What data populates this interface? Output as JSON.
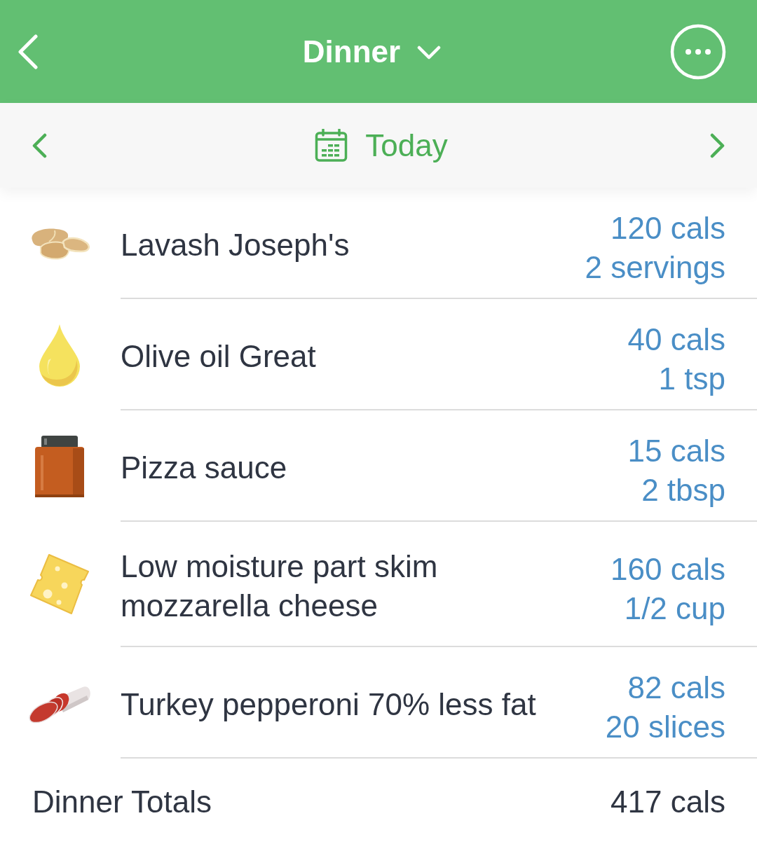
{
  "header": {
    "title": "Dinner"
  },
  "date_bar": {
    "label": "Today"
  },
  "entries": [
    {
      "kind": "bread",
      "name": "Lavash Joseph's",
      "calories": "120 cals",
      "serving": "2 servings"
    },
    {
      "kind": "oil",
      "name": "Olive oil Great",
      "calories": "40 cals",
      "serving": "1 tsp"
    },
    {
      "kind": "jar",
      "name": "Pizza sauce",
      "calories": "15 cals",
      "serving": "2 tbsp"
    },
    {
      "kind": "cheese",
      "name": "Low moisture part skim mozzarella cheese",
      "calories": "160 cals",
      "serving": "1/2 cup"
    },
    {
      "kind": "pepperoni",
      "name": "Turkey pepperoni 70% less fat",
      "calories": "82 cals",
      "serving": "20 slices"
    }
  ],
  "totals": {
    "label": "Dinner Totals",
    "calories": "417 cals"
  }
}
